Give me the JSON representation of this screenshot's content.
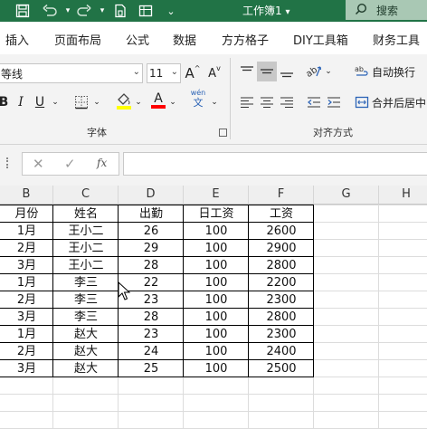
{
  "titlebar": {
    "title": "工作簿1",
    "title_caret": "▾",
    "search_label": "搜索",
    "bg_color": "#217346"
  },
  "tabs": [
    "插入",
    "页面布局",
    "公式",
    "数据",
    "方方格子",
    "DIY工具箱",
    "财务工具"
  ],
  "ribbon": {
    "font_name": "等线",
    "font_size": "11",
    "grow_font": "A",
    "shrink_font": "A",
    "bold": "B",
    "italic": "I",
    "underline": "U",
    "font_color_letter": "A",
    "phonetic": "wén",
    "phonetic_char": "文",
    "wrap_text": "自动换行",
    "merge_center": "合并后居中",
    "font_group_label": "字体",
    "align_group_label": "对齐方式",
    "highlight_color": "#ffff00",
    "font_color": "#ff0000"
  },
  "formula_bar": {
    "fx_label": "fx",
    "value": ""
  },
  "columns": [
    "B",
    "C",
    "D",
    "E",
    "F",
    "G",
    "H"
  ],
  "table": {
    "headers": [
      "月份",
      "姓名",
      "出勤",
      "日工资",
      "工资"
    ],
    "rows": [
      [
        "1月",
        "王小二",
        "26",
        "100",
        "2600"
      ],
      [
        "2月",
        "王小二",
        "29",
        "100",
        "2900"
      ],
      [
        "3月",
        "王小二",
        "28",
        "100",
        "2800"
      ],
      [
        "1月",
        "李三",
        "22",
        "100",
        "2200"
      ],
      [
        "2月",
        "李三",
        "23",
        "100",
        "2300"
      ],
      [
        "3月",
        "李三",
        "28",
        "100",
        "2800"
      ],
      [
        "1月",
        "赵大",
        "23",
        "100",
        "2300"
      ],
      [
        "2月",
        "赵大",
        "24",
        "100",
        "2400"
      ],
      [
        "3月",
        "赵大",
        "25",
        "100",
        "2500"
      ]
    ]
  }
}
